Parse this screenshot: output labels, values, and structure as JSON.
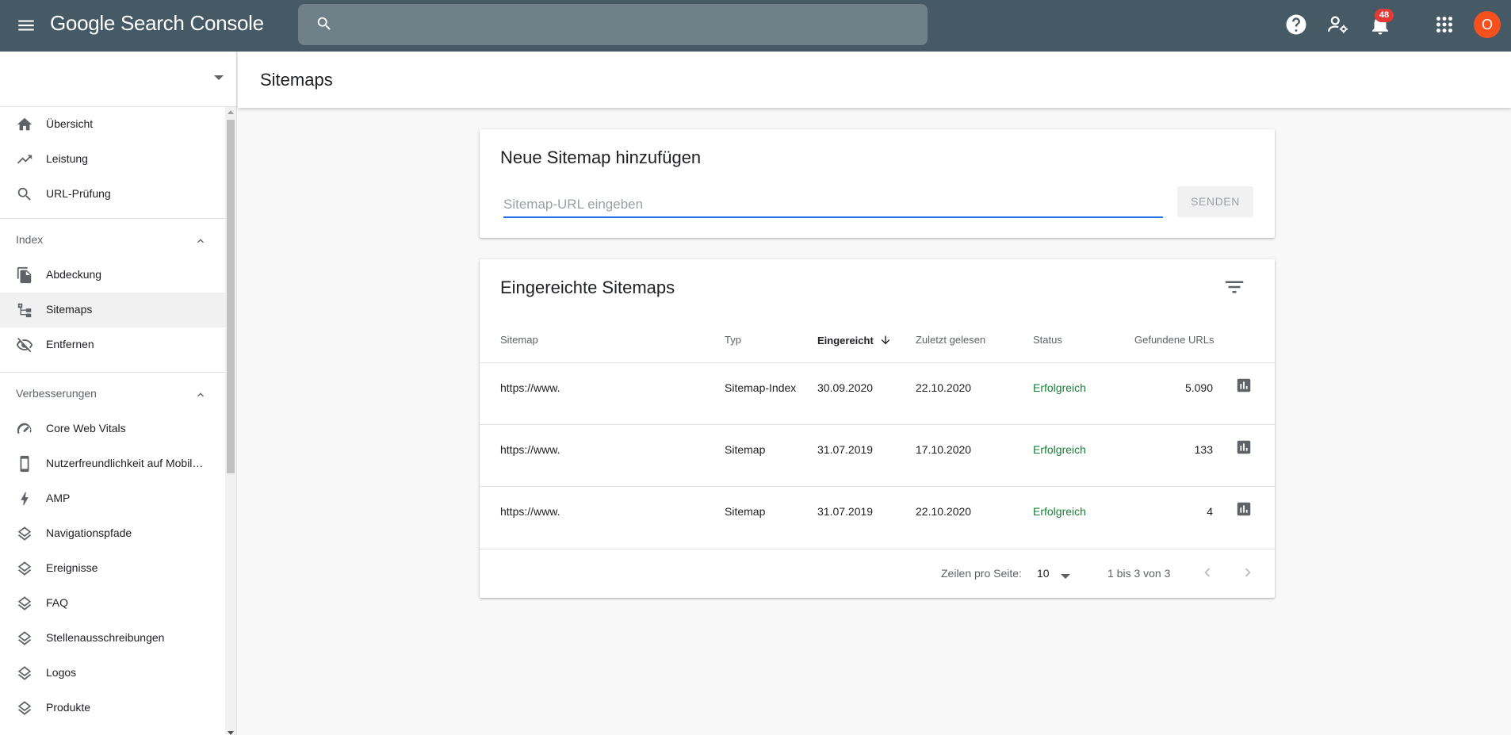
{
  "topbar": {
    "logo_text": "Google Search Console",
    "search_placeholder": "",
    "notification_count": "48",
    "avatar_letter": "O"
  },
  "sidebar": {
    "property_name": "",
    "items_top": [
      {
        "label": "Übersicht",
        "icon": "home-icon"
      },
      {
        "label": "Leistung",
        "icon": "trending-up-icon"
      },
      {
        "label": "URL-Prüfung",
        "icon": "search-icon"
      }
    ],
    "section_index": {
      "label": "Index",
      "items": [
        {
          "label": "Abdeckung",
          "icon": "file-copy-icon"
        },
        {
          "label": "Sitemaps",
          "icon": "sitemap-icon"
        },
        {
          "label": "Entfernen",
          "icon": "visibility-off-icon"
        }
      ]
    },
    "section_enhancements": {
      "label": "Verbesserungen",
      "items": [
        {
          "label": "Core Web Vitals",
          "icon": "speedometer-icon"
        },
        {
          "label": "Nutzerfreundlichkeit auf Mobilgeräten",
          "icon": "smartphone-icon"
        },
        {
          "label": "AMP",
          "icon": "lightning-icon"
        },
        {
          "label": "Navigationspfade",
          "icon": "layers-icon"
        },
        {
          "label": "Ereignisse",
          "icon": "layers-icon"
        },
        {
          "label": "FAQ",
          "icon": "layers-icon"
        },
        {
          "label": "Stellenausschreibungen",
          "icon": "layers-icon"
        },
        {
          "label": "Logos",
          "icon": "layers-icon"
        },
        {
          "label": "Produkte",
          "icon": "layers-icon"
        }
      ]
    },
    "active_item": "Sitemaps"
  },
  "page": {
    "title": "Sitemaps"
  },
  "add_sitemap": {
    "title": "Neue Sitemap hinzufügen",
    "input_placeholder": "Sitemap-URL eingeben",
    "input_value": "",
    "submit_label": "SENDEN"
  },
  "submitted": {
    "title": "Eingereichte Sitemaps",
    "columns": {
      "sitemap": "Sitemap",
      "type": "Typ",
      "submitted": "Eingereicht",
      "last_read": "Zuletzt gelesen",
      "status": "Status",
      "found_urls": "Gefundene URLs"
    },
    "sort_column": "Eingereicht",
    "sort_direction": "descending",
    "rows": [
      {
        "sitemap": "https://www.",
        "type": "Sitemap-Index",
        "submitted": "30.09.2020",
        "last_read": "22.10.2020",
        "status": "Erfolgreich",
        "found_urls": "5.090"
      },
      {
        "sitemap": "https://www.",
        "type": "Sitemap",
        "submitted": "31.07.2019",
        "last_read": "17.10.2020",
        "status": "Erfolgreich",
        "found_urls": "133"
      },
      {
        "sitemap": "https://www.",
        "type": "Sitemap",
        "submitted": "31.07.2019",
        "last_read": "22.10.2020",
        "status": "Erfolgreich",
        "found_urls": "4"
      }
    ],
    "footer": {
      "rows_per_page_label": "Zeilen pro Seite:",
      "rows_per_page_value": "10",
      "range_text": "1 bis 3 von 3"
    }
  },
  "colors": {
    "topbar": "#455a64",
    "accent": "#1a73e8",
    "status_success": "#188038",
    "avatar": "#f4511e",
    "badge": "#e53935"
  }
}
